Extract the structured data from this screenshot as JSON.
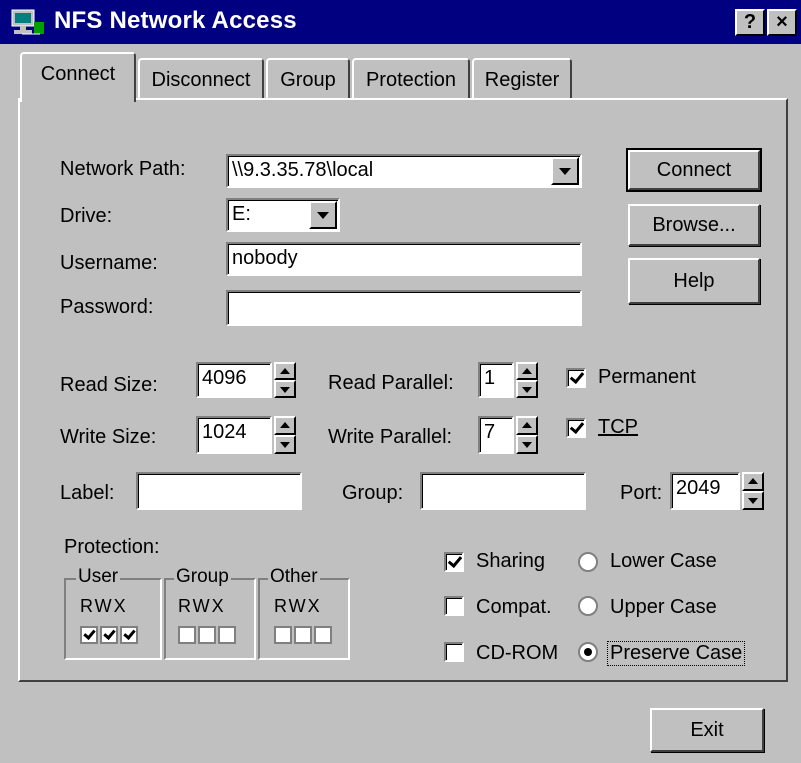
{
  "window": {
    "title": "NFS Network Access",
    "help_button": "?",
    "close_button": "×"
  },
  "tabs": [
    {
      "label": "Connect",
      "active": true
    },
    {
      "label": "Disconnect",
      "active": false
    },
    {
      "label": "Group",
      "active": false
    },
    {
      "label": "Protection",
      "active": false
    },
    {
      "label": "Register",
      "active": false
    }
  ],
  "form": {
    "network_path": {
      "label": "Network Path:",
      "value": "\\\\9.3.35.78\\local"
    },
    "drive": {
      "label": "Drive:",
      "value": "E:"
    },
    "username": {
      "label": "Username:",
      "value": "nobody"
    },
    "password": {
      "label": "Password:",
      "value": ""
    },
    "read_size": {
      "label": "Read Size:",
      "value": "4096"
    },
    "write_size": {
      "label": "Write Size:",
      "value": "1024"
    },
    "read_parallel": {
      "label": "Read Parallel:",
      "value": "1"
    },
    "write_parallel": {
      "label": "Write Parallel:",
      "value": "7"
    },
    "permanent": {
      "label": "Permanent",
      "checked": true
    },
    "tcp": {
      "label": "TCP",
      "checked": true
    },
    "label_field": {
      "label": "Label:",
      "value": ""
    },
    "group_field": {
      "label": "Group:",
      "value": ""
    },
    "port": {
      "label": "Port:",
      "value": "2049"
    }
  },
  "protection": {
    "label": "Protection:",
    "groups": [
      {
        "name": "User",
        "rwx": "RWX",
        "checks": [
          true,
          true,
          true
        ]
      },
      {
        "name": "Group",
        "rwx": "RWX",
        "checks": [
          false,
          false,
          false
        ]
      },
      {
        "name": "Other",
        "rwx": "RWX",
        "checks": [
          false,
          false,
          false
        ]
      }
    ]
  },
  "options": {
    "sharing": {
      "label": "Sharing",
      "checked": true
    },
    "compat": {
      "label": "Compat.",
      "checked": false
    },
    "cdrom": {
      "label": "CD-ROM",
      "checked": false
    },
    "lower_case": {
      "label": "Lower Case",
      "selected": false
    },
    "upper_case": {
      "label": "Upper Case",
      "selected": false
    },
    "preserve_case": {
      "label": "Preserve Case",
      "selected": true
    }
  },
  "buttons": {
    "connect": "Connect",
    "browse": "Browse...",
    "help": "Help",
    "exit": "Exit"
  }
}
